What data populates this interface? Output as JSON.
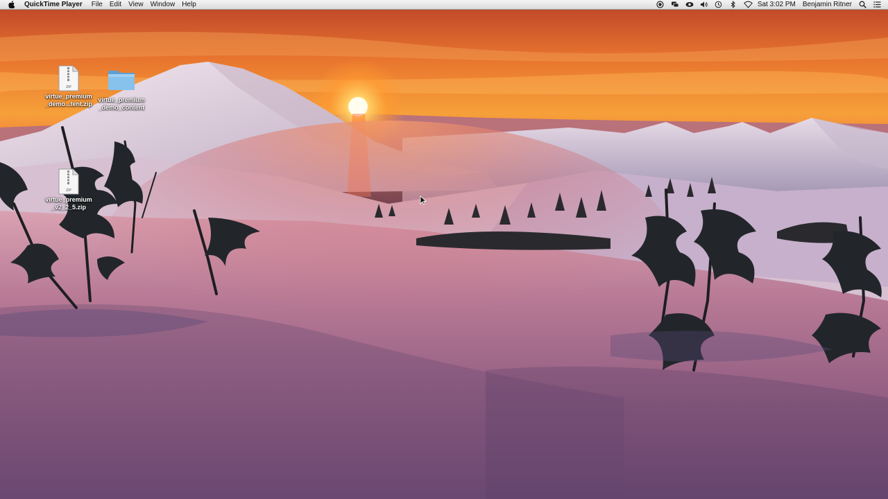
{
  "menubar": {
    "app_name": "QuickTime Player",
    "menus": [
      "File",
      "Edit",
      "View",
      "Window",
      "Help"
    ],
    "status_icons": [
      "record-icon",
      "messages-icon",
      "eye-icon",
      "volume-icon",
      "time-machine-icon",
      "bluetooth-icon",
      "wifi-icon"
    ],
    "clock": "Sat 3:02 PM",
    "user": "Benjamin Ritner"
  },
  "desktop": {
    "icons": [
      {
        "type": "zip",
        "badge": "ZIP",
        "line1": "virtue_premium",
        "line2": "_demo...tent.zip"
      },
      {
        "type": "folder",
        "line1": "virtue_premium",
        "line2": "_demo_content"
      },
      {
        "type": "zip",
        "badge": "ZIP",
        "line1": "virtue_premium",
        "line2": "_v2_2_5.zip"
      }
    ]
  },
  "colors": {
    "sky_top": "#e0642a",
    "sky_glow": "#ff9a30",
    "snow_shadow": "#6a4e72",
    "snow_lit": "#c86a6a",
    "folder_blue": "#7bbbe6"
  }
}
